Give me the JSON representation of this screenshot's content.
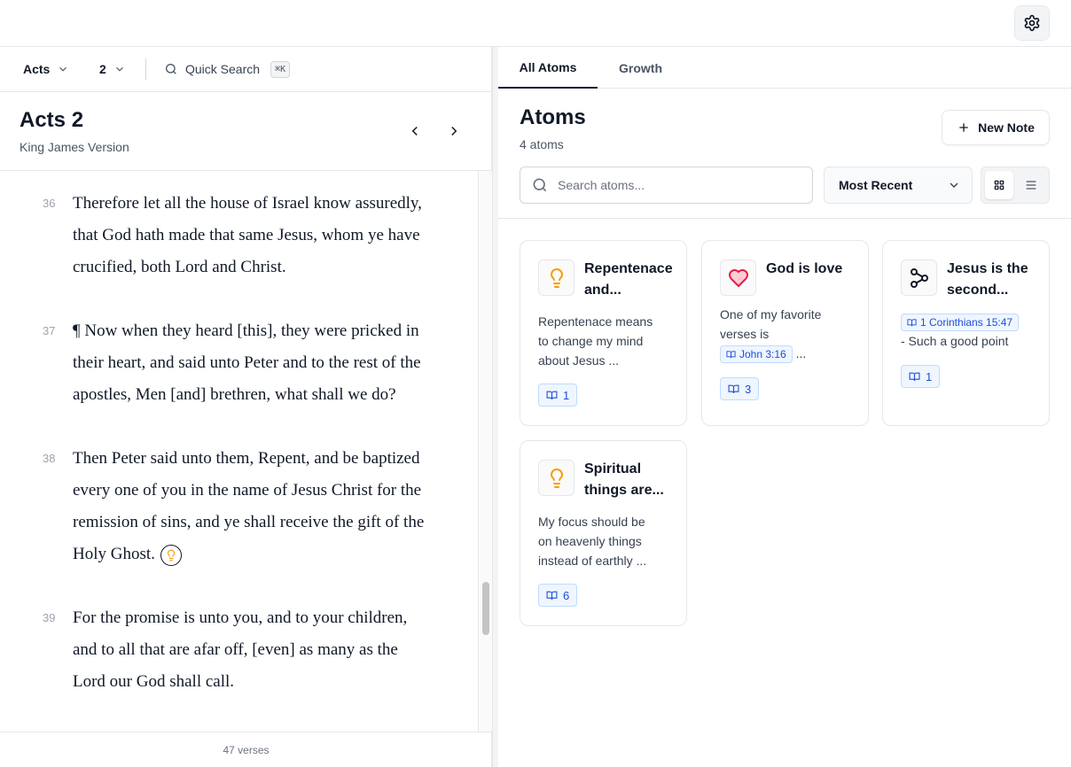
{
  "colors": {
    "accent": "#1d4ed8",
    "bulb": "#f59e0b",
    "heart": "#e11d48"
  },
  "reader": {
    "book": "Acts",
    "chapter": "2",
    "quick_search": "Quick Search",
    "shortcut": "⌘K",
    "title": "Acts 2",
    "version": "King James Version",
    "verses": [
      {
        "num": "36",
        "lines": [
          "Therefore let all the house of Israel know assuredly,",
          "that God hath made that same Jesus, whom ye have",
          "crucified, both Lord and Christ."
        ]
      },
      {
        "num": "37",
        "lines": [
          "¶ Now when they heard [this], they were pricked in",
          "their heart, and said unto Peter and to the rest of the",
          "apostles, Men [and] brethren, what shall we do?"
        ]
      },
      {
        "num": "38",
        "lines": [
          "Then Peter said unto them, Repent, and be baptized",
          "every one of you in the name of Jesus Christ for the",
          "remission of sins, and ye shall receive the gift of the",
          "Holy Ghost."
        ],
        "atom_icon": "lightbulb-icon"
      },
      {
        "num": "39",
        "lines": [
          "For the promise is unto you, and to your children,",
          "and to all that are afar off, [even] as many as the",
          "Lord our God shall call."
        ]
      }
    ],
    "footer": "47 verses"
  },
  "tabs": [
    "All Atoms",
    "Growth"
  ],
  "atoms": {
    "title": "Atoms",
    "count": "4 atoms",
    "new_note": "New Note",
    "search_placeholder": "Search atoms...",
    "sort": "Most Recent",
    "view": "grid",
    "cards": [
      {
        "icon": "lightbulb-icon",
        "title": [
          "Repentenace",
          "and..."
        ],
        "body": [
          "Repentenace means",
          "to change my mind",
          "about Jesus ..."
        ],
        "links": "1"
      },
      {
        "icon": "heart-icon",
        "title": [
          "God is love"
        ],
        "body_pre": [
          "One of my favorite",
          "verses is"
        ],
        "ref": "John 3:16",
        "body_post": "...",
        "links": "3"
      },
      {
        "icon": "connection-icon",
        "title": [
          "Jesus is the",
          "second..."
        ],
        "ref": "1 Corinthians 15:47",
        "body_post": "- Such a good point",
        "links": "1"
      },
      {
        "icon": "lightbulb-icon",
        "title": [
          "Spiritual",
          "things are..."
        ],
        "body": [
          "My focus should be",
          "on heavenly things",
          "instead of earthly ..."
        ],
        "links": "6"
      }
    ]
  }
}
